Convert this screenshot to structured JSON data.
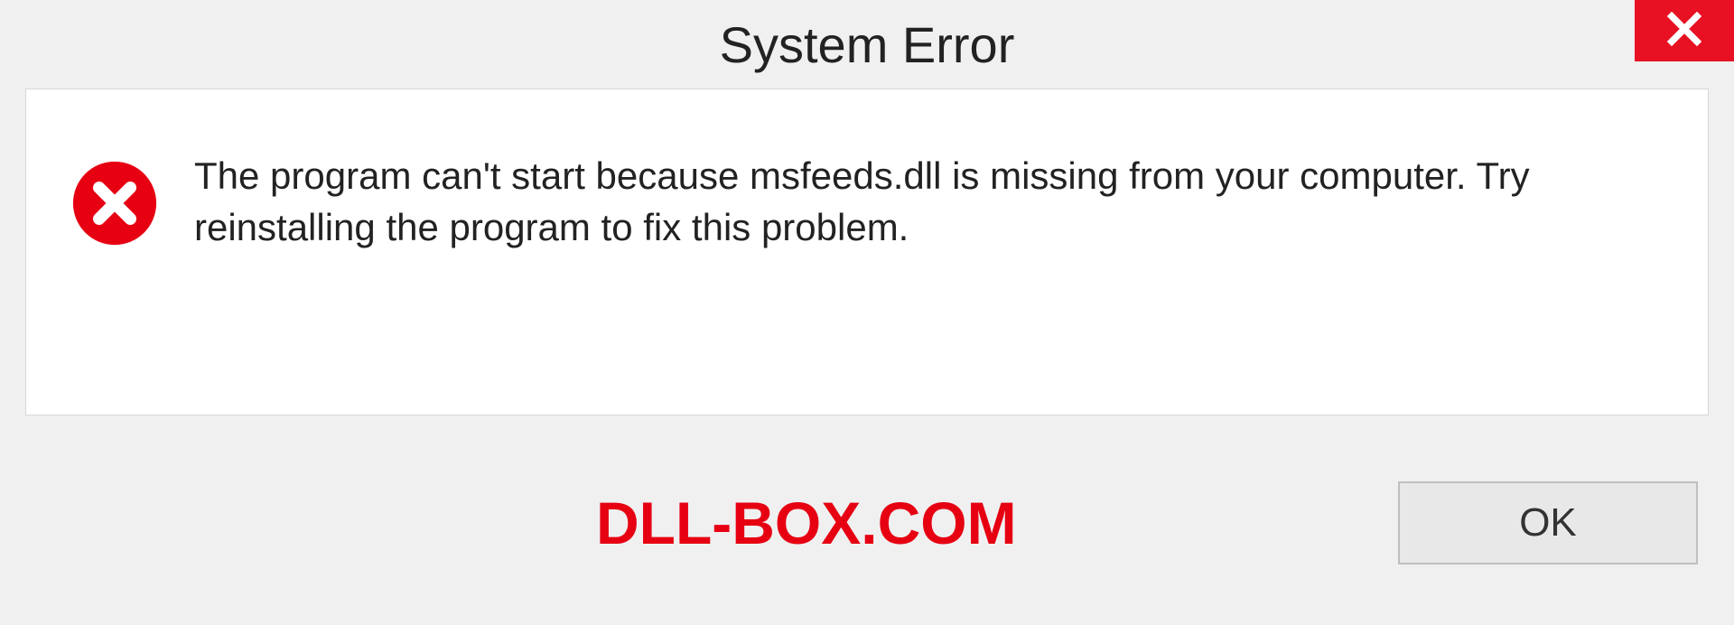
{
  "dialog": {
    "title": "System Error",
    "message": "The program can't start because msfeeds.dll is missing from your computer. Try reinstalling the program to fix this problem.",
    "ok_label": "OK"
  },
  "watermark": "DLL-BOX.COM",
  "colors": {
    "close_bg": "#e81123",
    "error_icon": "#e60012",
    "watermark": "#e60012"
  }
}
